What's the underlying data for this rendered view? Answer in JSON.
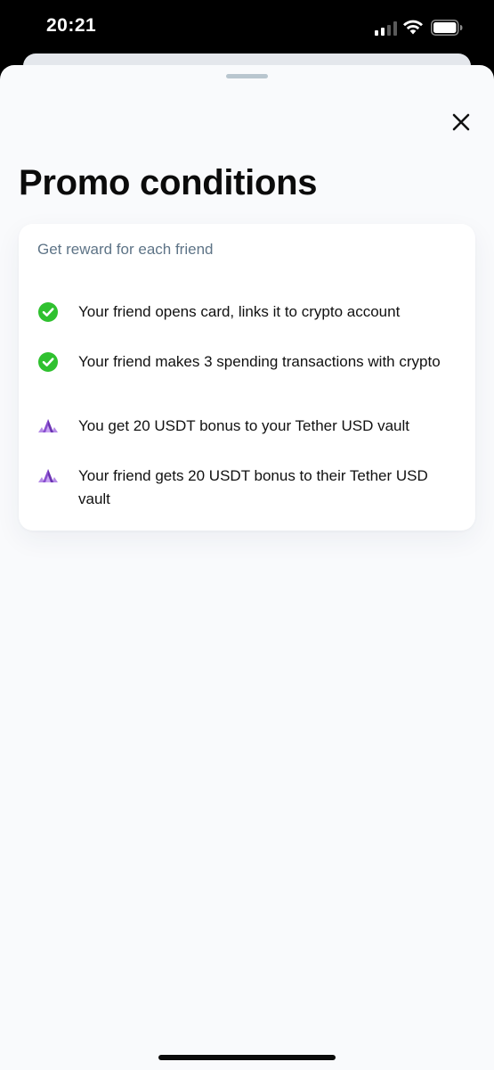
{
  "status_bar": {
    "time": "20:21"
  },
  "sheet": {
    "title": "Promo conditions",
    "close_icon": "close-icon"
  },
  "card": {
    "subtitle": "Get reward for each friend",
    "items": [
      {
        "icon": "check-circle-icon",
        "text": "Your friend opens card, links it to crypto account"
      },
      {
        "icon": "check-circle-icon",
        "text": "Your friend makes 3 spending transactions with crypto"
      },
      {
        "icon": "crystal-icon",
        "text": "You get 20 USDT bonus to your Tether USD vault"
      },
      {
        "icon": "crystal-icon",
        "text": "Your friend gets 20 USDT bonus to their Tether USD vault"
      }
    ]
  },
  "colors": {
    "check_green": "#2fc12f",
    "crystal_purple": "#8a4fd0",
    "subtitle": "#5e7487",
    "sheet_bg": "#f9fafc"
  }
}
